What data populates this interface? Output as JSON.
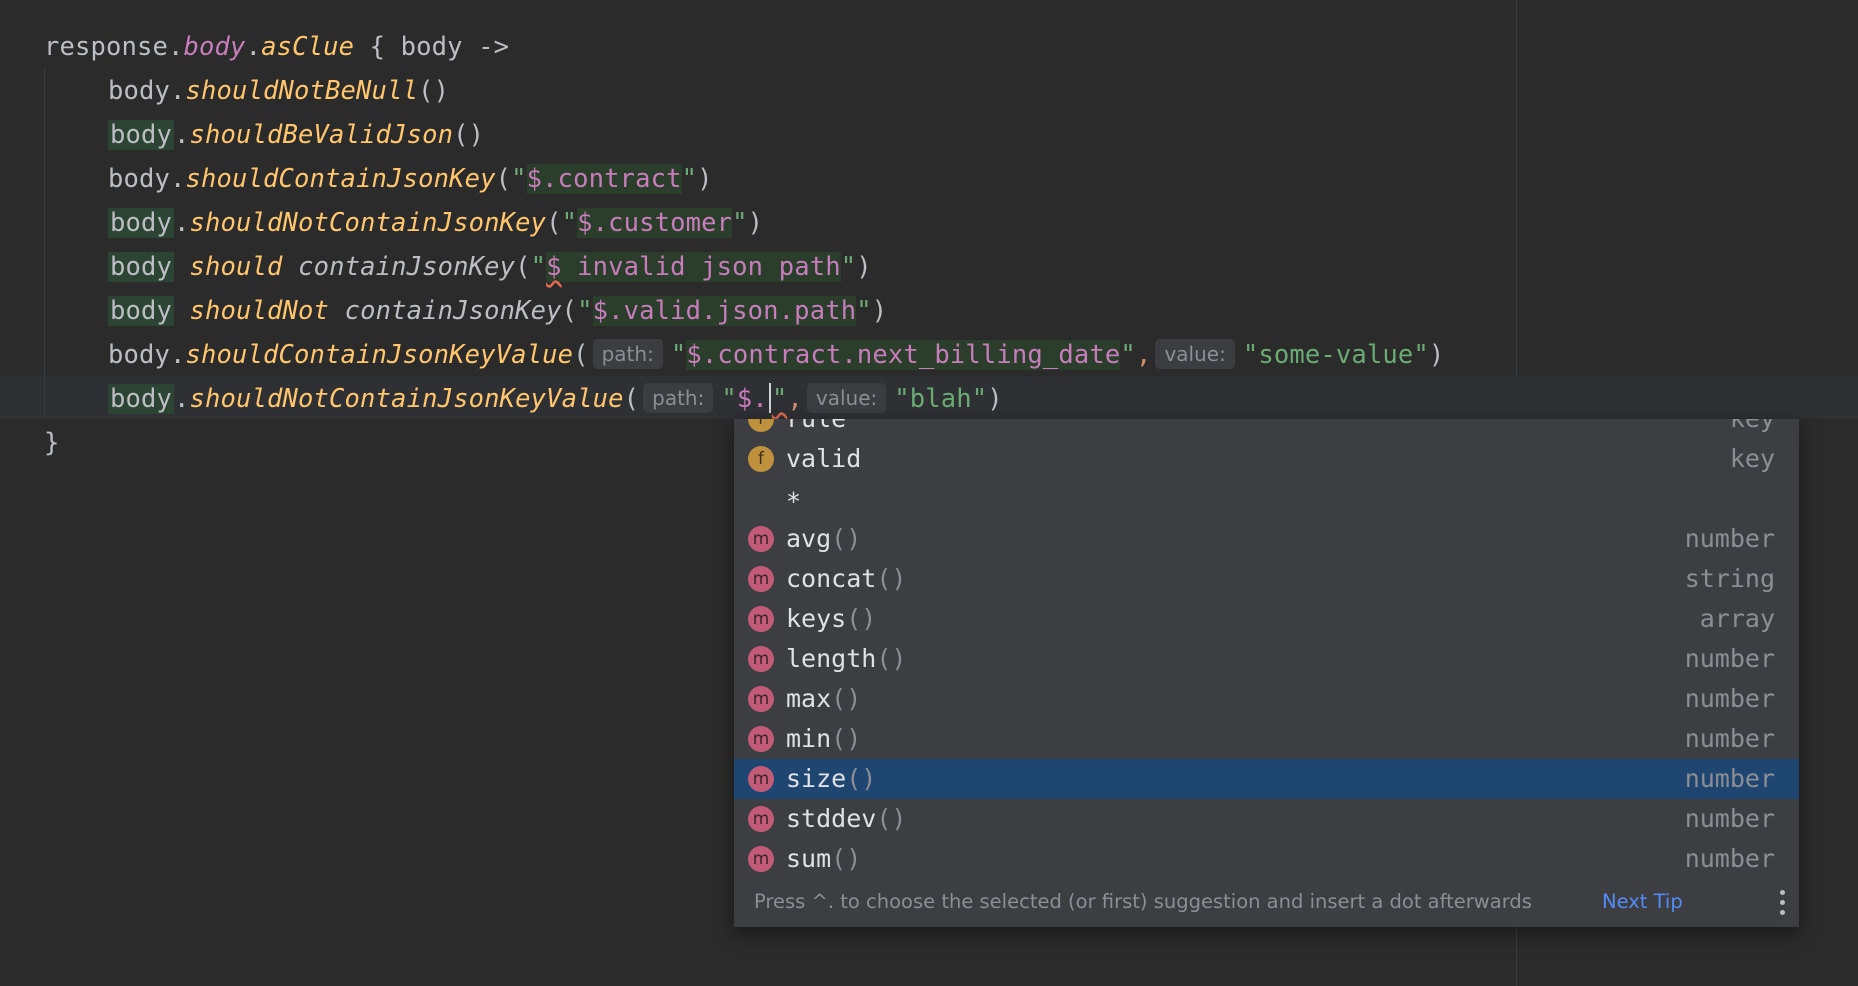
{
  "editor": {
    "line1": {
      "receiver": "response",
      "prop": "body",
      "fn": "asClue",
      "open": " { ",
      "param": "body",
      "arrow": " ->"
    },
    "line2": {
      "recv": "body",
      "fn": "shouldNotBeNull",
      "rest": "()"
    },
    "line3": {
      "recv": "body",
      "fn": "shouldBeValidJson",
      "rest": "()"
    },
    "line4": {
      "recv": "body",
      "fn": "shouldContainJsonKey",
      "path": "$.contract"
    },
    "line5": {
      "recv": "body",
      "fn": "shouldNotContainJsonKey",
      "path": "$.customer"
    },
    "line6": {
      "recv": "body",
      "infix": "should",
      "fn": "containJsonKey",
      "path_a": "$",
      "path_b": " invalid json path"
    },
    "line7": {
      "recv": "body",
      "infix": "shouldNot",
      "fn": "containJsonKey",
      "path": "$.valid.json.path"
    },
    "line8": {
      "recv": "body",
      "fn": "shouldContainJsonKeyValue",
      "hint_path": "path:",
      "path": "$.contract.next_billing_date",
      "hint_value": "value:",
      "value": "\"some-value\""
    },
    "line9": {
      "recv": "body",
      "fn": "shouldNotContainJsonKeyValue",
      "hint_path": "path:",
      "path": "$.",
      "hint_value": "value:",
      "value": "\"blah\""
    },
    "line10": {
      "close": "}"
    }
  },
  "completion": {
    "items": [
      {
        "icon": "f",
        "icon_name": "field-icon",
        "name": "rule",
        "parens": "",
        "type": "key"
      },
      {
        "icon": "f",
        "icon_name": "field-icon",
        "name": "valid",
        "parens": "",
        "type": "key"
      },
      {
        "icon": "",
        "icon_name": "",
        "name": "*",
        "parens": "",
        "type": ""
      },
      {
        "icon": "m",
        "icon_name": "method-icon",
        "name": "avg",
        "parens": "()",
        "type": "number"
      },
      {
        "icon": "m",
        "icon_name": "method-icon",
        "name": "concat",
        "parens": "()",
        "type": "string"
      },
      {
        "icon": "m",
        "icon_name": "method-icon",
        "name": "keys",
        "parens": "()",
        "type": "array"
      },
      {
        "icon": "m",
        "icon_name": "method-icon",
        "name": "length",
        "parens": "()",
        "type": "number"
      },
      {
        "icon": "m",
        "icon_name": "method-icon",
        "name": "max",
        "parens": "()",
        "type": "number"
      },
      {
        "icon": "m",
        "icon_name": "method-icon",
        "name": "min",
        "parens": "()",
        "type": "number"
      },
      {
        "icon": "m",
        "icon_name": "method-icon",
        "name": "size",
        "parens": "()",
        "type": "number",
        "selected": true
      },
      {
        "icon": "m",
        "icon_name": "method-icon",
        "name": "stddev",
        "parens": "()",
        "type": "number"
      },
      {
        "icon": "m",
        "icon_name": "method-icon",
        "name": "sum",
        "parens": "()",
        "type": "number"
      }
    ],
    "footer_tip": "Press ^. to choose the selected (or first) suggestion and insert a dot afterwards",
    "next_tip": "Next Tip"
  },
  "colors": {
    "background": "#2b2b2b",
    "selection": "#1f4670",
    "method_icon": "#c25b78",
    "field_icon": "#c0913d",
    "link": "#548af7"
  }
}
